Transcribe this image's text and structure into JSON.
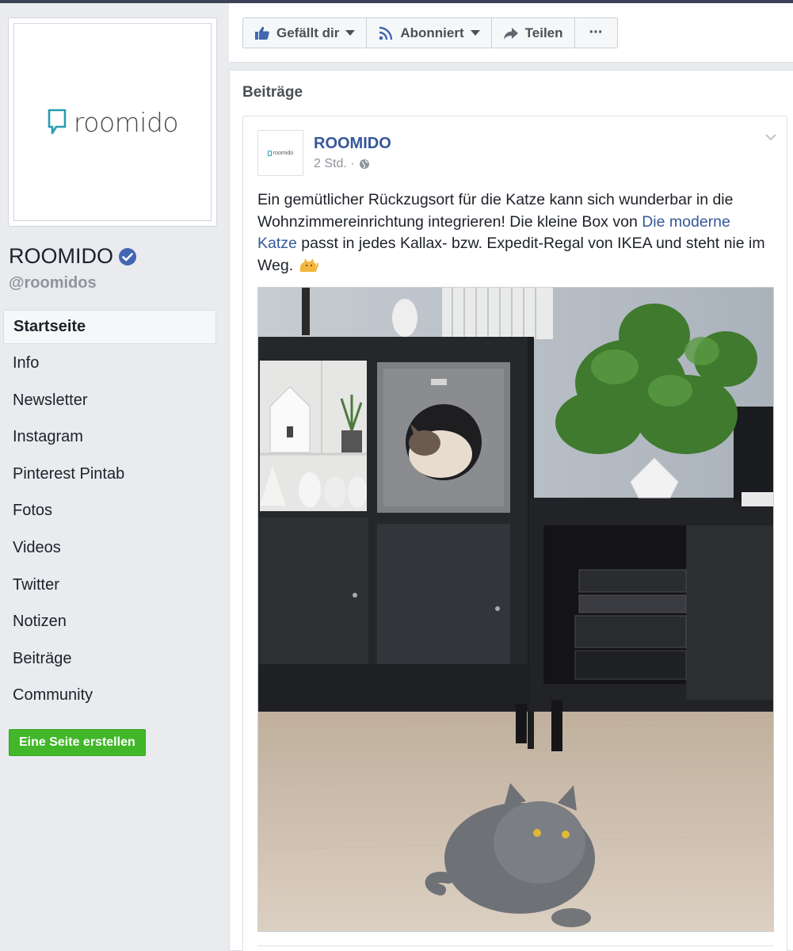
{
  "sidebar": {
    "logo_text": "roomido",
    "page_name": "ROOMIDO",
    "handle": "@roomidos",
    "nav": [
      {
        "label": "Startseite",
        "active": true
      },
      {
        "label": "Info"
      },
      {
        "label": "Newsletter"
      },
      {
        "label": "Instagram"
      },
      {
        "label": "Pinterest Pintab"
      },
      {
        "label": "Fotos"
      },
      {
        "label": "Videos"
      },
      {
        "label": "Twitter"
      },
      {
        "label": "Notizen"
      },
      {
        "label": "Beiträge"
      },
      {
        "label": "Community"
      }
    ],
    "create_page_label": "Eine Seite erstellen"
  },
  "actions": {
    "like_label": "Gefällt dir",
    "follow_label": "Abonniert",
    "share_label": "Teilen",
    "more_label": "···"
  },
  "posts": {
    "heading": "Beiträge",
    "items": [
      {
        "author": "ROOMIDO",
        "avatar_text": "roomido",
        "time": "2 Std. ·",
        "text_before_link": "Ein gemütlicher Rückzugsort für die Katze kann sich wunderbar in die Wohnzimmereinrichtung integrieren! Die kleine Box von ",
        "link_text": "Die moderne Katze",
        "text_after_link": " passt in jedes Kallax- bzw. Expedit-Regal von IKEA und steht nie im Weg. "
      }
    ]
  },
  "colors": {
    "link": "#365899",
    "logo_accent": "#2a9bb0",
    "create_button": "#42b72a",
    "verified": "#4267b2"
  },
  "icons": [
    "thumbs-up-icon",
    "rss-icon",
    "share-arrow-icon",
    "globe-icon",
    "chevron-down-icon",
    "verified-badge-icon",
    "cat-emoji-icon"
  ]
}
